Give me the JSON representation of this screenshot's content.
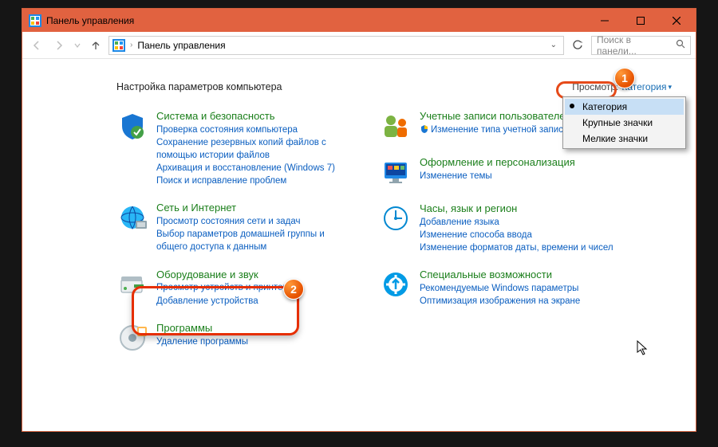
{
  "titlebar": {
    "title": "Панель управления"
  },
  "address": {
    "text": "Панель управления"
  },
  "search": {
    "placeholder": "Поиск в панели..."
  },
  "header": {
    "title": "Настройка параметров компьютера",
    "view_label": "Просмотр:",
    "view_value": "Категория"
  },
  "dropdown": {
    "items": [
      "Категория",
      "Крупные значки",
      "Мелкие значки"
    ],
    "selected": 0
  },
  "left": [
    {
      "title": "Система и безопасность",
      "links": [
        "Проверка состояния компьютера",
        "Сохранение резервных копий файлов с помощью истории файлов",
        "Архивация и восстановление (Windows 7)",
        "Поиск и исправление проблем"
      ]
    },
    {
      "title": "Сеть и Интернет",
      "links": [
        "Просмотр состояния сети и задач",
        "Выбор параметров домашней группы и общего доступа к данным"
      ]
    },
    {
      "title": "Оборудование и звук",
      "links": [
        "Просмотр устройств и принтеров",
        "Добавление устройства"
      ]
    },
    {
      "title": "Программы",
      "links": [
        "Удаление программы"
      ]
    }
  ],
  "right": [
    {
      "title": "Учетные записи пользователей",
      "links": [
        "Изменение типа учетной записи"
      ],
      "shield": true
    },
    {
      "title": "Оформление и персонализация",
      "links": [
        "Изменение темы"
      ]
    },
    {
      "title": "Часы, язык и регион",
      "links": [
        "Добавление языка",
        "Изменение способа ввода",
        "Изменение форматов даты, времени и чисел"
      ]
    },
    {
      "title": "Специальные возможности",
      "links": [
        "Рекомендуемые Windows параметры",
        "Оптимизация изображения на экране"
      ]
    }
  ],
  "badges": {
    "b1": "1",
    "b2": "2"
  }
}
